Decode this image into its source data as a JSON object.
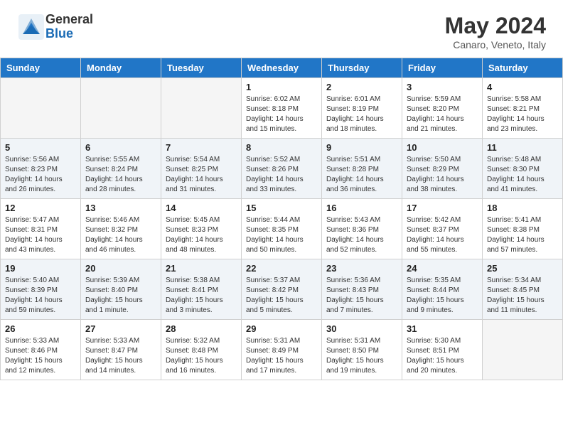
{
  "header": {
    "logo_general": "General",
    "logo_blue": "Blue",
    "month_title": "May 2024",
    "location": "Canaro, Veneto, Italy"
  },
  "days_of_week": [
    "Sunday",
    "Monday",
    "Tuesday",
    "Wednesday",
    "Thursday",
    "Friday",
    "Saturday"
  ],
  "weeks": [
    [
      {
        "day": "",
        "info": ""
      },
      {
        "day": "",
        "info": ""
      },
      {
        "day": "",
        "info": ""
      },
      {
        "day": "1",
        "info": "Sunrise: 6:02 AM\nSunset: 8:18 PM\nDaylight: 14 hours\nand 15 minutes."
      },
      {
        "day": "2",
        "info": "Sunrise: 6:01 AM\nSunset: 8:19 PM\nDaylight: 14 hours\nand 18 minutes."
      },
      {
        "day": "3",
        "info": "Sunrise: 5:59 AM\nSunset: 8:20 PM\nDaylight: 14 hours\nand 21 minutes."
      },
      {
        "day": "4",
        "info": "Sunrise: 5:58 AM\nSunset: 8:21 PM\nDaylight: 14 hours\nand 23 minutes."
      }
    ],
    [
      {
        "day": "5",
        "info": "Sunrise: 5:56 AM\nSunset: 8:23 PM\nDaylight: 14 hours\nand 26 minutes."
      },
      {
        "day": "6",
        "info": "Sunrise: 5:55 AM\nSunset: 8:24 PM\nDaylight: 14 hours\nand 28 minutes."
      },
      {
        "day": "7",
        "info": "Sunrise: 5:54 AM\nSunset: 8:25 PM\nDaylight: 14 hours\nand 31 minutes."
      },
      {
        "day": "8",
        "info": "Sunrise: 5:52 AM\nSunset: 8:26 PM\nDaylight: 14 hours\nand 33 minutes."
      },
      {
        "day": "9",
        "info": "Sunrise: 5:51 AM\nSunset: 8:28 PM\nDaylight: 14 hours\nand 36 minutes."
      },
      {
        "day": "10",
        "info": "Sunrise: 5:50 AM\nSunset: 8:29 PM\nDaylight: 14 hours\nand 38 minutes."
      },
      {
        "day": "11",
        "info": "Sunrise: 5:48 AM\nSunset: 8:30 PM\nDaylight: 14 hours\nand 41 minutes."
      }
    ],
    [
      {
        "day": "12",
        "info": "Sunrise: 5:47 AM\nSunset: 8:31 PM\nDaylight: 14 hours\nand 43 minutes."
      },
      {
        "day": "13",
        "info": "Sunrise: 5:46 AM\nSunset: 8:32 PM\nDaylight: 14 hours\nand 46 minutes."
      },
      {
        "day": "14",
        "info": "Sunrise: 5:45 AM\nSunset: 8:33 PM\nDaylight: 14 hours\nand 48 minutes."
      },
      {
        "day": "15",
        "info": "Sunrise: 5:44 AM\nSunset: 8:35 PM\nDaylight: 14 hours\nand 50 minutes."
      },
      {
        "day": "16",
        "info": "Sunrise: 5:43 AM\nSunset: 8:36 PM\nDaylight: 14 hours\nand 52 minutes."
      },
      {
        "day": "17",
        "info": "Sunrise: 5:42 AM\nSunset: 8:37 PM\nDaylight: 14 hours\nand 55 minutes."
      },
      {
        "day": "18",
        "info": "Sunrise: 5:41 AM\nSunset: 8:38 PM\nDaylight: 14 hours\nand 57 minutes."
      }
    ],
    [
      {
        "day": "19",
        "info": "Sunrise: 5:40 AM\nSunset: 8:39 PM\nDaylight: 14 hours\nand 59 minutes."
      },
      {
        "day": "20",
        "info": "Sunrise: 5:39 AM\nSunset: 8:40 PM\nDaylight: 15 hours\nand 1 minute."
      },
      {
        "day": "21",
        "info": "Sunrise: 5:38 AM\nSunset: 8:41 PM\nDaylight: 15 hours\nand 3 minutes."
      },
      {
        "day": "22",
        "info": "Sunrise: 5:37 AM\nSunset: 8:42 PM\nDaylight: 15 hours\nand 5 minutes."
      },
      {
        "day": "23",
        "info": "Sunrise: 5:36 AM\nSunset: 8:43 PM\nDaylight: 15 hours\nand 7 minutes."
      },
      {
        "day": "24",
        "info": "Sunrise: 5:35 AM\nSunset: 8:44 PM\nDaylight: 15 hours\nand 9 minutes."
      },
      {
        "day": "25",
        "info": "Sunrise: 5:34 AM\nSunset: 8:45 PM\nDaylight: 15 hours\nand 11 minutes."
      }
    ],
    [
      {
        "day": "26",
        "info": "Sunrise: 5:33 AM\nSunset: 8:46 PM\nDaylight: 15 hours\nand 12 minutes."
      },
      {
        "day": "27",
        "info": "Sunrise: 5:33 AM\nSunset: 8:47 PM\nDaylight: 15 hours\nand 14 minutes."
      },
      {
        "day": "28",
        "info": "Sunrise: 5:32 AM\nSunset: 8:48 PM\nDaylight: 15 hours\nand 16 minutes."
      },
      {
        "day": "29",
        "info": "Sunrise: 5:31 AM\nSunset: 8:49 PM\nDaylight: 15 hours\nand 17 minutes."
      },
      {
        "day": "30",
        "info": "Sunrise: 5:31 AM\nSunset: 8:50 PM\nDaylight: 15 hours\nand 19 minutes."
      },
      {
        "day": "31",
        "info": "Sunrise: 5:30 AM\nSunset: 8:51 PM\nDaylight: 15 hours\nand 20 minutes."
      },
      {
        "day": "",
        "info": ""
      }
    ]
  ]
}
